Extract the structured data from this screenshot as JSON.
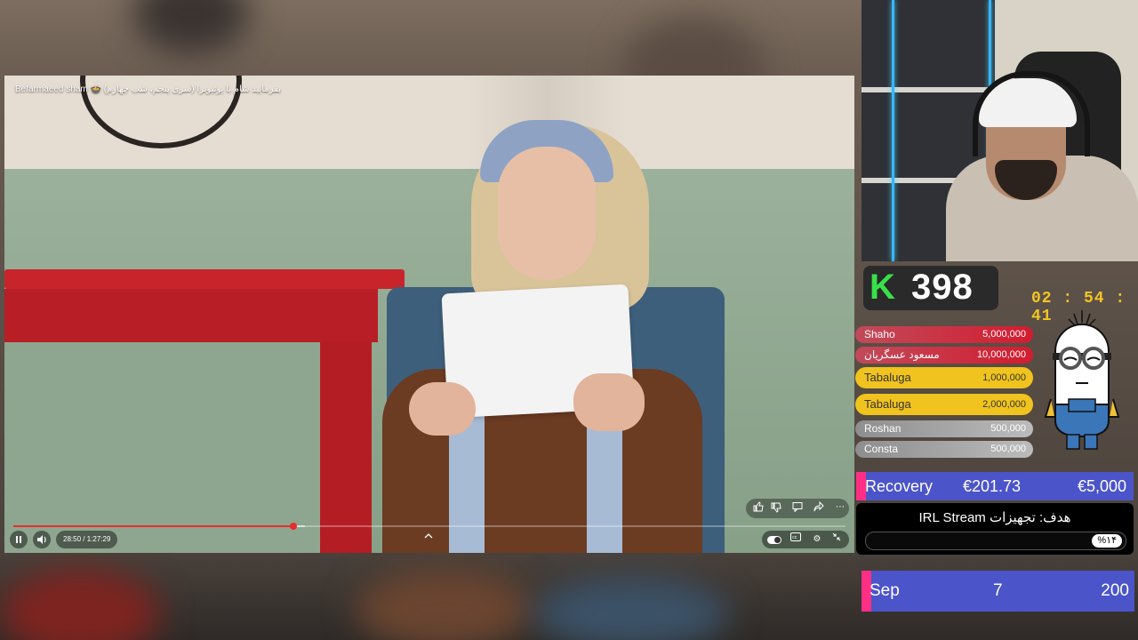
{
  "video": {
    "title": "Befarmaeed sham 🍲 بفرمایید شام با یوتیوبرا (سری پنجم، شب چهارم)",
    "current_time": "28:50",
    "duration": "1:27:29",
    "progress_fraction": 0.337,
    "buffered_fraction": 0.35
  },
  "player_icons": {
    "play_pause": "pause-icon",
    "volume": "volume-icon",
    "expand": "chevron-up-icon",
    "autoplay": "toggle-icon",
    "captions": "captions-icon",
    "settings": "gear-icon",
    "fullscreen": "exit-fullscreen-icon",
    "like": "thumbs-up-icon",
    "dislike": "thumbs-down-icon",
    "comment": "comment-icon",
    "share": "share-icon",
    "more": "more-icon"
  },
  "kick": {
    "logo": "K",
    "count": "398",
    "timer": "02 : 54 : 41"
  },
  "donors": [
    {
      "name": "Shaho",
      "amount": "5,000,000",
      "style": "red"
    },
    {
      "name": "مسعود عسگریان",
      "amount": "10,000,000",
      "style": "red"
    },
    {
      "name": "Tabaluga",
      "amount": "1,000,000",
      "style": "gold"
    },
    {
      "name": "Tabaluga",
      "amount": "2,000,000",
      "style": "gold"
    },
    {
      "name": "Roshan",
      "amount": "500,000",
      "style": "grey"
    },
    {
      "name": "Consta",
      "amount": "500,000",
      "style": "grey"
    }
  ],
  "recovery": {
    "label": "Recovery",
    "current": "€201.73",
    "target": "€5,000"
  },
  "goal": {
    "title": "هدف: تجهیزات IRL Stream",
    "percent": "%۱۴"
  },
  "sep": {
    "label": "Sep",
    "value": "7",
    "target": "200"
  },
  "colors": {
    "kick_green": "#39e04a",
    "timer_yellow": "#f3c623",
    "bar_blue": "#4b54c9",
    "accent_pink": "#ff2f86",
    "progress_red": "#e52d2d"
  }
}
